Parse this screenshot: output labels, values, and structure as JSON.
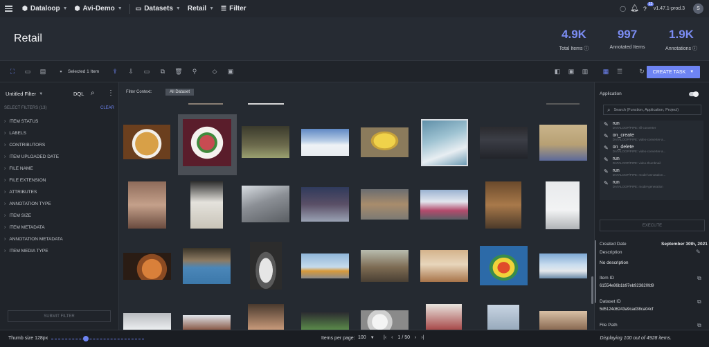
{
  "topbar": {
    "project": "Dataloop",
    "demo": "Avi-Demo",
    "datasets": "Datasets",
    "dataset": "Retail",
    "filter": "Filter",
    "version": "v1.47.1-prod.3",
    "notif_count": "12",
    "avatar_letter": "S"
  },
  "header": {
    "title": "Retail",
    "stats": [
      {
        "value": "4.9K",
        "label": "Total Items"
      },
      {
        "value": "997",
        "label": "Annotated Items"
      },
      {
        "value": "1.9K",
        "label": "Annotations"
      }
    ]
  },
  "toolbar": {
    "selected": "Selected 1 Item",
    "create_task": "CREATE TASK"
  },
  "left": {
    "filter_name": "Untitled Filter",
    "dql": "DQL",
    "select_filters": "SELECT FILTERS (13)",
    "clear": "CLEAR",
    "filters": [
      "ITEM STATUS",
      "LABELS",
      "CONTRIBUTORS",
      "ITEM UPLOADED DATE",
      "FILE NAME",
      "FILE EXTENSION",
      "ATTRIBUTES",
      "ANNOTATION TYPE",
      "ITEM SIZE",
      "ITEM METADATA",
      "ANNOTATION METADATA",
      "ITEM MEDIA TYPE"
    ],
    "submit": "SUBMIT FILTER"
  },
  "center": {
    "filter_context": "Filter Context:",
    "all_dataset": "All Dataset"
  },
  "right": {
    "application": "Application",
    "search_placeholder": "Search (Function, Application, Project)",
    "functions": [
      {
        "name": "run",
        "sub": "DATALOOP/PIPE: sfl-converter"
      },
      {
        "name": "on_create",
        "sub": "DATALOOP/PIPE: video-converter-a..."
      },
      {
        "name": "on_delete",
        "sub": "DATALOOP/PIPE: video-converter-a..."
      },
      {
        "name": "run",
        "sub": "DATALOOP/PIPE: video-thumbnail"
      },
      {
        "name": "run",
        "sub": "DATALOOP/PIPE: model-annotation..."
      },
      {
        "name": "run",
        "sub": "DATALOOP/PIPE: model-generation"
      }
    ],
    "execute": "EXECUTE",
    "created_date_label": "Created Date",
    "created_date": "September 30th, 2021",
    "description_label": "Description",
    "description": "No description",
    "item_id_label": "Item ID",
    "item_id": "61554e86b1b97eb923820fd9",
    "dataset_id_label": "Dataset ID",
    "dataset_id": "5d5124d6243a9cad38ca04cf",
    "file_path_label": "File Path"
  },
  "footer": {
    "thumb_size": "Thumb size 128px",
    "items_per_page_label": "Items per page:",
    "items_per_page": "100",
    "page": "1 / 50",
    "displaying": "Displaying 100 out of 4928 items."
  },
  "colors": {
    "accent": "#6e84f3",
    "stat": "#7b8cf2"
  }
}
